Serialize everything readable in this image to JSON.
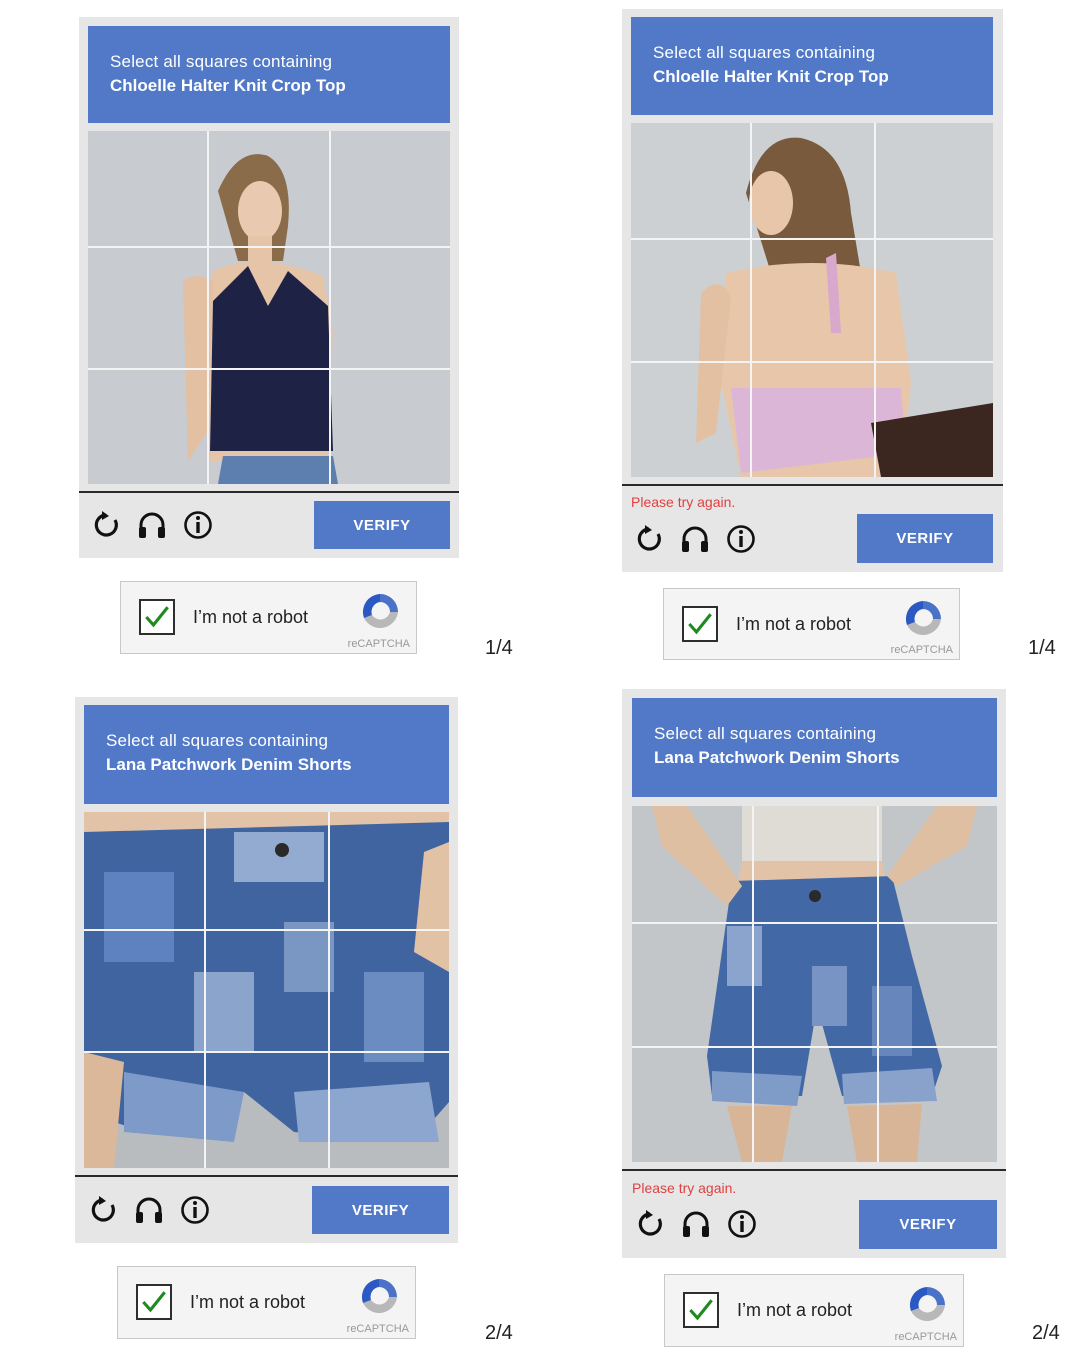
{
  "panels": [
    {
      "prompt": "Select all squares containing",
      "item": "Chloelle Halter Knit Crop Top",
      "error": "",
      "verify": "VERIFY",
      "robot_label": "I’m not a robot",
      "recaptcha": "reCAPTCHA",
      "step": "1/4"
    },
    {
      "prompt": "Select all squares containing",
      "item": "Chloelle Halter Knit Crop Top",
      "error": "Please try again.",
      "verify": "VERIFY",
      "robot_label": "I’m not a robot",
      "recaptcha": "reCAPTCHA",
      "step": "1/4"
    },
    {
      "prompt": "Select all squares containing",
      "item": "Lana Patchwork Denim Shorts",
      "error": "",
      "verify": "VERIFY",
      "robot_label": "I’m not a robot",
      "recaptcha": "reCAPTCHA",
      "step": "2/4"
    },
    {
      "prompt": "Select all squares containing",
      "item": "Lana Patchwork Denim Shorts",
      "error": "Please try again.",
      "verify": "VERIFY",
      "robot_label": "I’m not a robot",
      "recaptcha": "reCAPTCHA",
      "step": "2/4"
    }
  ],
  "icons": [
    "reload-icon",
    "headphones-icon",
    "info-icon"
  ],
  "colors": {
    "accent": "#5179c7",
    "error": "#e04040",
    "check": "#1f8a1f"
  }
}
